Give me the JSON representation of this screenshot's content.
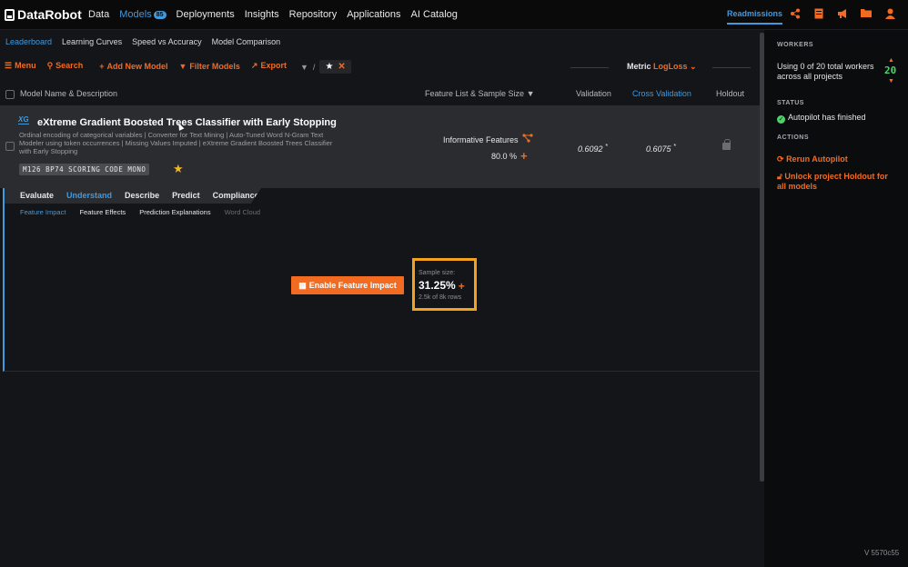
{
  "topbar": {
    "logo": "DataRobot",
    "nav": [
      {
        "label": "Data"
      },
      {
        "label": "Models",
        "badge": "85"
      },
      {
        "label": "Deployments"
      },
      {
        "label": "Insights"
      },
      {
        "label": "Repository"
      },
      {
        "label": "Applications"
      },
      {
        "label": "AI Catalog"
      }
    ],
    "project": "Readmissions",
    "icons": [
      "share-icon",
      "document-icon",
      "megaphone-icon",
      "folder-icon",
      "user-icon"
    ]
  },
  "subnav": [
    "Leaderboard",
    "Learning Curves",
    "Speed vs Accuracy",
    "Model Comparison"
  ],
  "toolbar": {
    "menu": "Menu",
    "search": "Search",
    "add_model": "Add New Model",
    "filter": "Filter Models",
    "export": "Export",
    "separator": "/"
  },
  "metric": {
    "label": "Metric",
    "value": "LogLoss"
  },
  "columns": {
    "name": "Model Name & Description",
    "feature_list": "Feature List & Sample Size",
    "validation": "Validation",
    "cross_validation": "Cross Validation",
    "holdout": "Holdout"
  },
  "model": {
    "badge": "XG",
    "title": "eXtreme Gradient Boosted Trees Classifier with Early Stopping",
    "description": "Ordinal encoding of categorical variables | Converter for Text Mining | Auto-Tuned Word N-Gram Text Modeler using token occurrences | Missing Values Imputed | eXtreme Gradient Boosted Trees Classifier with Early Stopping",
    "tags": "M126  BP74  SCORING CODE  MONO",
    "feature_list": "Informative Features",
    "sample_pct": "80.0 %",
    "validation": "0.6092",
    "cross_validation": "0.6075",
    "star_marker": "*"
  },
  "model_tabs": [
    "Evaluate",
    "Understand",
    "Describe",
    "Predict",
    "Compliance"
  ],
  "sub_tabs": [
    "Feature Impact",
    "Feature Effects",
    "Prediction Explanations",
    "Word Cloud"
  ],
  "feature_impact": {
    "button": "Enable Feature Impact",
    "sample_label": "Sample size:",
    "sample_value": "31.25%",
    "sample_rows": "2.5k of 8k rows"
  },
  "sidebar": {
    "workers_heading": "WORKERS",
    "workers_text": "Using 0 of 20 total workers across all projects",
    "workers_count": "20",
    "status_heading": "STATUS",
    "status_text": "Autopilot has finished",
    "actions_heading": "ACTIONS",
    "rerun": "Rerun Autopilot",
    "unlock": "Unlock project Holdout for all models",
    "version": "V 5570c55"
  }
}
